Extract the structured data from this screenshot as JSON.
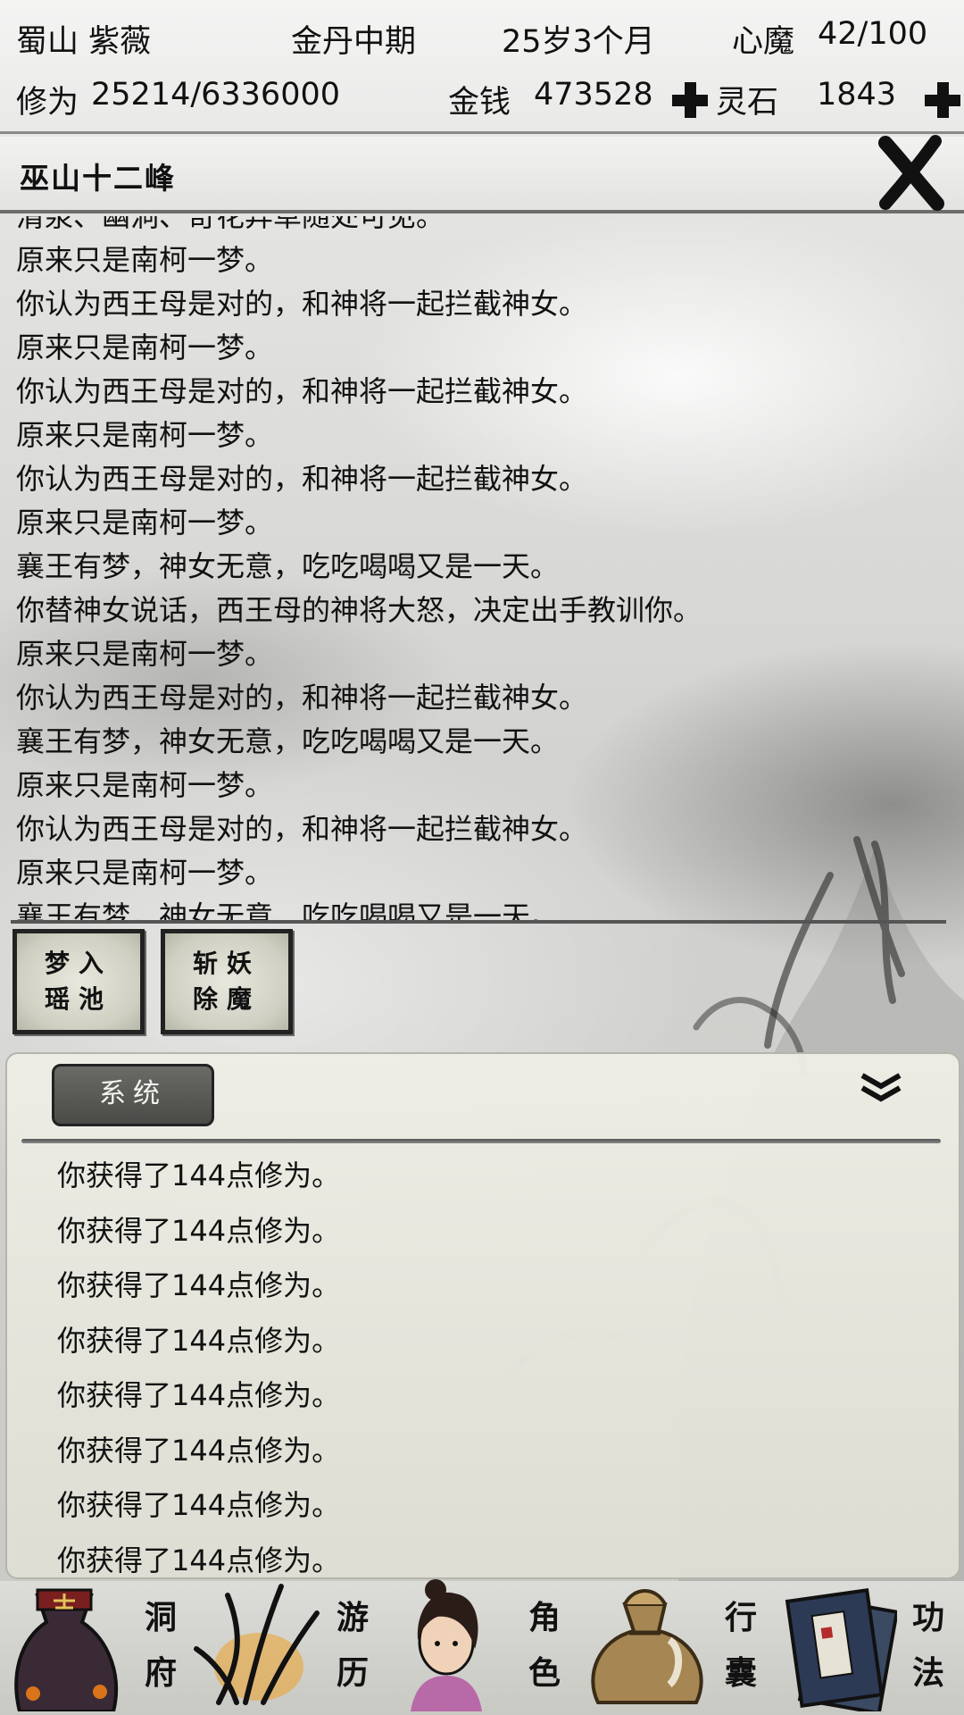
{
  "header": {
    "sect_name": "蜀山 紫薇",
    "realm": "金丹中期",
    "age": "25岁3个月",
    "demon_label": "心魔",
    "demon_value": "42/100",
    "cultivation_label": "修为",
    "cultivation_value": "25214/6336000",
    "money_label": "金钱",
    "money_value": "473528",
    "spirit_stone_label": "灵石",
    "spirit_stone_value": "1843"
  },
  "location": {
    "title": "巫山十二峰"
  },
  "story": {
    "lines": [
      "清泉、幽洞、奇花异草随处可见。",
      "原来只是南柯一梦。",
      "你认为西王母是对的，和神将一起拦截神女。",
      "原来只是南柯一梦。",
      "你认为西王母是对的，和神将一起拦截神女。",
      "原来只是南柯一梦。",
      "你认为西王母是对的，和神将一起拦截神女。",
      "原来只是南柯一梦。",
      "襄王有梦，神女无意，吃吃喝喝又是一天。",
      "你替神女说话，西王母的神将大怒，决定出手教训你。",
      "原来只是南柯一梦。",
      "你认为西王母是对的，和神将一起拦截神女。",
      "襄王有梦，神女无意，吃吃喝喝又是一天。",
      "原来只是南柯一梦。",
      "你认为西王母是对的，和神将一起拦截神女。",
      "原来只是南柯一梦。",
      "襄王有梦，神女无意，吃吃喝喝又是一天。"
    ]
  },
  "actions": {
    "dream_line1": "梦入",
    "dream_line2": "瑶池",
    "slay_line1": "斩妖",
    "slay_line2": "除魔"
  },
  "system_panel": {
    "tab_label": "系统",
    "messages": [
      "你获得了144点修为。",
      "你获得了144点修为。",
      "你获得了144点修为。",
      "你获得了144点修为。",
      "你获得了144点修为。",
      "你获得了144点修为。",
      "你获得了144点修为。",
      "你获得了144点修为。"
    ]
  },
  "nav": {
    "cave": [
      "洞",
      "府"
    ],
    "travel": [
      "游",
      "历"
    ],
    "character": [
      "角",
      "色"
    ],
    "bag": [
      "行",
      "囊"
    ],
    "skills": [
      "功",
      "法"
    ]
  },
  "colors": {
    "ink": "#111111",
    "paper": "#e9e9e8",
    "tab_bg": "#4a4a47"
  },
  "icons": {
    "close": "brush-x-icon",
    "plus": "plus-icon",
    "collapse": "double-chevron-down-icon"
  }
}
